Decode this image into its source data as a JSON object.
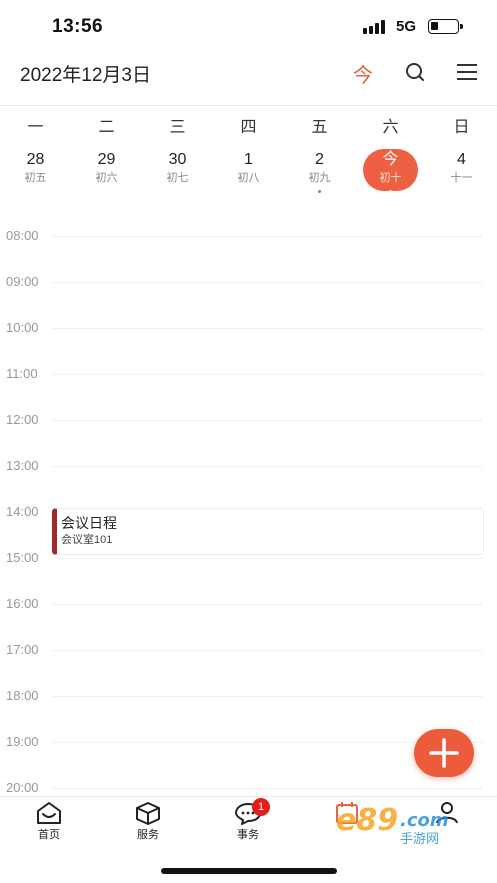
{
  "status_bar": {
    "time": "13:56",
    "network": "5G",
    "battery_level": 0.3
  },
  "header": {
    "date": "2022年12月3日",
    "today_label": "今",
    "icons": [
      "search-icon",
      "menu-icon"
    ]
  },
  "week": {
    "weekdays": [
      "一",
      "二",
      "三",
      "四",
      "五",
      "六",
      "日"
    ],
    "days": [
      {
        "num": "28",
        "lunar": "初五",
        "has_event": false
      },
      {
        "num": "29",
        "lunar": "初六",
        "has_event": false
      },
      {
        "num": "30",
        "lunar": "初七",
        "has_event": false
      },
      {
        "num": "1",
        "lunar": "初八",
        "has_event": false
      },
      {
        "num": "2",
        "lunar": "初九",
        "has_event": true
      },
      {
        "num": "今",
        "lunar": "初十",
        "has_event": true,
        "selected": true
      },
      {
        "num": "4",
        "lunar": "十一",
        "has_event": false
      }
    ],
    "accent_color": "#ed6142"
  },
  "timeline": {
    "hours": [
      "08:00",
      "09:00",
      "10:00",
      "11:00",
      "12:00",
      "13:00",
      "14:00",
      "15:00",
      "16:00",
      "17:00",
      "18:00",
      "19:00",
      "20:00"
    ],
    "events": [
      {
        "title": "会议日程",
        "location": "会议室101",
        "color": "#9c2b2b"
      }
    ]
  },
  "fab": {
    "icon": "plus-icon"
  },
  "bottom_nav": {
    "items": [
      {
        "label": "首页",
        "icon": "home-icon"
      },
      {
        "label": "服务",
        "icon": "box-icon"
      },
      {
        "label": "事务",
        "icon": "chat-icon",
        "badge": "1"
      },
      {
        "label": "",
        "icon": "calendar-icon"
      },
      {
        "label": "",
        "icon": "user-icon"
      }
    ]
  },
  "watermark": {
    "text": "e89.com 手游网"
  }
}
